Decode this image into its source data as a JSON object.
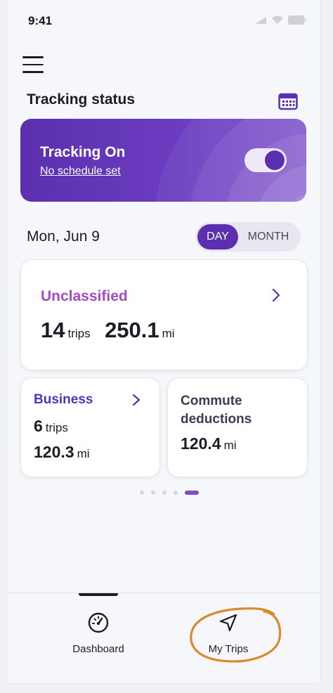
{
  "status_bar": {
    "time": "9:41"
  },
  "header": {
    "section_title": "Tracking status"
  },
  "tracking": {
    "title": "Tracking On",
    "subtitle": "No schedule set",
    "toggle_on": true
  },
  "date_row": {
    "date": "Mon, Jun 9",
    "toggle_options": [
      "DAY",
      "MONTH"
    ],
    "selected": "DAY"
  },
  "unclassified": {
    "title": "Unclassified",
    "trips": "14",
    "trips_unit": "trips",
    "distance": "250.1",
    "distance_unit": "mi"
  },
  "business": {
    "title": "Business",
    "trips": "6",
    "trips_unit": "trips",
    "distance": "120.3",
    "distance_unit": "mi"
  },
  "commute": {
    "title_line1": "Commute",
    "title_line2": "deductions",
    "distance": "120.4",
    "distance_unit": "mi"
  },
  "pagination": {
    "count": 5,
    "active_index": 4
  },
  "tabbar": {
    "dashboard_label": "Dashboard",
    "mytrips_label": "My Trips"
  },
  "colors": {
    "brand_purple": "#5c2fb0",
    "unclassified": "#a24bc4",
    "business": "#4a37c4",
    "annotation_orange": "#d98a2e"
  }
}
